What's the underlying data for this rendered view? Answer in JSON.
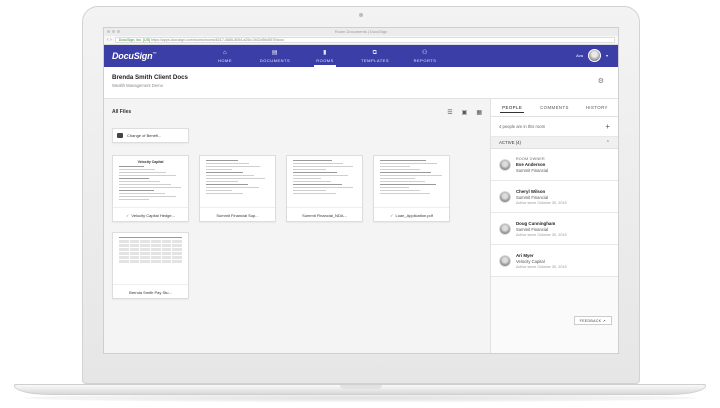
{
  "browser": {
    "window_title": "Room Documents | DocuSign",
    "url_secure": "DocuSign, Inc. [US]",
    "url": "https://apps.docusign.com/rooms/rooms/6317-4685-8054-a25d-0402d56c557f/docs"
  },
  "nav": {
    "logo": "DocuSign",
    "items": [
      {
        "label": "HOME",
        "icon": "home-icon",
        "glyph": "⌂"
      },
      {
        "label": "DOCUMENTS",
        "icon": "documents-icon",
        "glyph": "▤"
      },
      {
        "label": "ROOMS",
        "icon": "rooms-icon",
        "glyph": "▮"
      },
      {
        "label": "TEMPLATES",
        "icon": "templates-icon",
        "glyph": "⧉"
      },
      {
        "label": "REPORTS",
        "icon": "reports-icon",
        "glyph": "⚇"
      }
    ],
    "user_label": "Ava"
  },
  "room": {
    "title": "Brenda Smith Client Docs",
    "subtitle": "Wealth Management Demo"
  },
  "files": {
    "heading": "All Files",
    "folder": "Change of Benefi...",
    "docs": [
      {
        "label": "Velocity Capital Hedge...",
        "signed": true,
        "thumb_title": "Velocity Capital"
      },
      {
        "label": "Summit Financial Sup...",
        "signed": false,
        "thumb_title": ""
      },
      {
        "label": "Summit Financial_NDA...",
        "signed": false,
        "thumb_title": ""
      },
      {
        "label": "Loan_Application.pdf",
        "signed": true,
        "thumb_title": ""
      },
      {
        "label": "Brenda Smith Pay Stu...",
        "signed": false,
        "thumb_title": ""
      }
    ],
    "check_glyph": "✓"
  },
  "panel": {
    "tabs": [
      "PEOPLE",
      "COMMENTS",
      "HISTORY"
    ],
    "count_text": "4 people are in this room",
    "plus": "+",
    "active_label": "ACTIVE (4)",
    "chevron": "⌃",
    "people": [
      {
        "role": "ROOM OWNER",
        "name": "Eve Anderson",
        "org": "Summit Financial",
        "active": ""
      },
      {
        "role": "",
        "name": "Cheryl Wilson",
        "org": "Summit Financial",
        "active": "Active since October 30, 2015"
      },
      {
        "role": "",
        "name": "Doug Cunningham",
        "org": "Summit Financial",
        "active": "Active since October 30, 2015"
      },
      {
        "role": "",
        "name": "Ari Myer",
        "org": "Velocity Capital",
        "active": "Active since October 30, 2015"
      }
    ],
    "feedback": "FEEDBACK ↗"
  }
}
